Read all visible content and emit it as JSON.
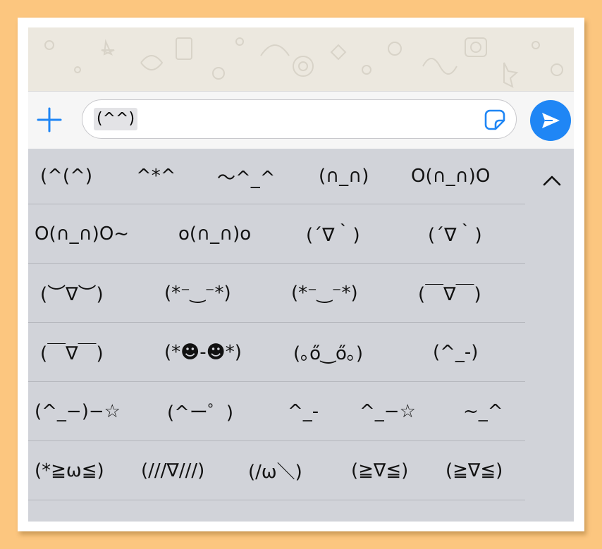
{
  "input": {
    "text": "(^^)"
  },
  "icons": {
    "plus": "plus-icon",
    "sticker": "sticker-icon",
    "send": "send-icon",
    "collapse": "chevron-up-icon"
  },
  "colors": {
    "accent": "#1f86f5",
    "keyboard_bg": "#d1d3d9",
    "page_bg": "#fcc67f"
  },
  "suggestions": [
    [
      "(^(^)",
      "^*^",
      "～^_^",
      "(∩_∩)",
      "O(∩_∩)O"
    ],
    [
      "O(∩_∩)O~",
      "o(∩_∩)o",
      "(´∇｀)",
      "(´∇｀)"
    ],
    [
      "(︶∇︶)",
      "(*⁻‿⁻*)",
      "(*⁻‿⁻*)",
      "(￣∇￣)"
    ],
    [
      "(￣∇￣)",
      "(*☻-☻*)",
      "(｡ő‿ő｡)",
      "(^_-)"
    ],
    [
      "(^_−)−☆",
      "(^ー゜)",
      "^_-",
      "^_−☆",
      "~_^"
    ],
    [
      "(*≧ω≦)",
      "(///∇///)",
      "(/ω＼)",
      "(≧∇≦)",
      "(≧∇≦)"
    ]
  ]
}
